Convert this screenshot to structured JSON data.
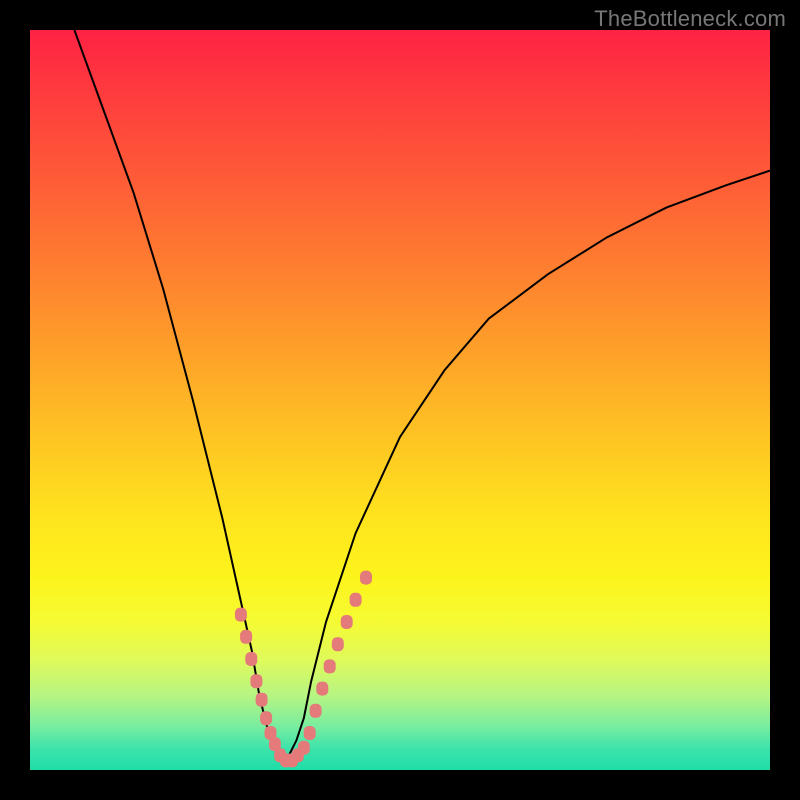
{
  "watermark": "TheBottleneck.com",
  "colors": {
    "frame": "#000000",
    "curve": "#000000",
    "marker": "#e47a7a",
    "gradient_top": "#fe2244",
    "gradient_bottom": "#1fdda8"
  },
  "chart_data": {
    "type": "line",
    "title": "",
    "xlabel": "",
    "ylabel": "",
    "xlim": [
      0,
      100
    ],
    "ylim": [
      0,
      100
    ],
    "grid": false,
    "legend": false,
    "note": "Axes are unlabeled; y=100 corresponds to the top of the plot (red) and y=0 to the bottom (green). The curve depicts a V-shaped bottleneck profile.",
    "series": [
      {
        "name": "bottleneck-curve",
        "x": [
          6,
          10,
          14,
          18,
          22,
          24,
          26,
          28,
          30,
          31,
          32,
          33,
          34,
          35,
          36,
          37,
          38,
          40,
          44,
          50,
          56,
          62,
          70,
          78,
          86,
          94,
          100
        ],
        "y": [
          100,
          89,
          78,
          65,
          50,
          42,
          34,
          25,
          16,
          10,
          6,
          3,
          1,
          2,
          4,
          7,
          12,
          20,
          32,
          45,
          54,
          61,
          67,
          72,
          76,
          79,
          81
        ]
      }
    ],
    "markers": {
      "left_arm": {
        "x": [
          28.5,
          29.2,
          29.9,
          30.6,
          31.3,
          31.9,
          32.5,
          33.1
        ],
        "y": [
          21,
          18,
          15,
          12,
          9.5,
          7,
          5,
          3.5
        ]
      },
      "bottom": {
        "x": [
          33.8,
          34.6,
          35.4,
          36.2,
          37.0
        ],
        "y": [
          2,
          1.3,
          1.3,
          2,
          3
        ]
      },
      "right_arm": {
        "x": [
          37.8,
          38.6,
          39.5,
          40.5,
          41.6,
          42.8,
          44.0,
          45.4
        ],
        "y": [
          5,
          8,
          11,
          14,
          17,
          20,
          23,
          26
        ]
      }
    }
  }
}
